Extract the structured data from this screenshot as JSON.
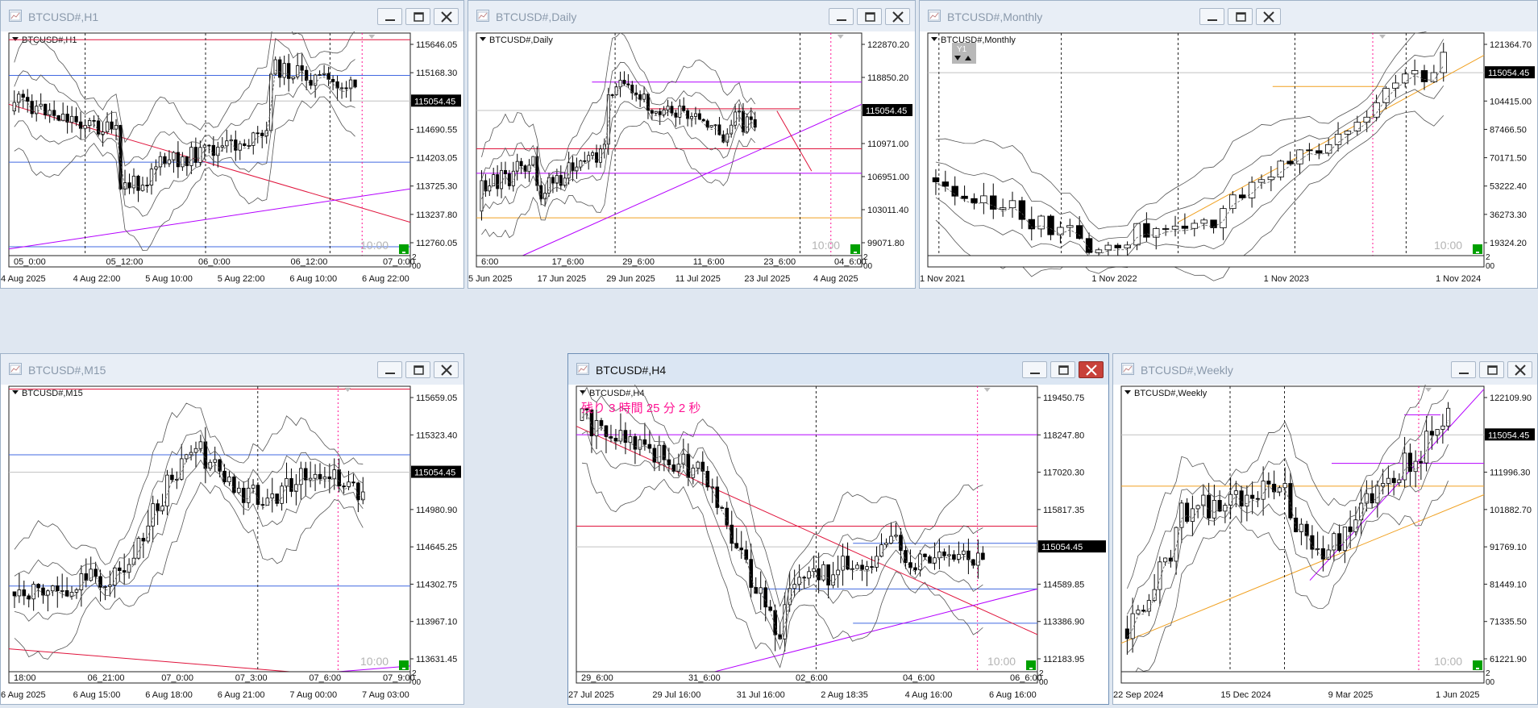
{
  "colors": {
    "red_line": "#e0143c",
    "blue_line": "#4169e1",
    "magenta_line": "#b400ff",
    "orange_line": "#f0a020",
    "price_label_bg": "#000000",
    "session_marker": "#ff1493",
    "bull_candle": "#ffffff",
    "bear_candle": "#000000",
    "green_box": "#00a000"
  },
  "session_label": "10:00",
  "windows": [
    {
      "id": "h1",
      "title": "BTCUSD#,H1",
      "label": "BTCUSD#,H1",
      "active": false,
      "prices": [
        "115646.05",
        "115168.30",
        "115054.45",
        "114690.55",
        "114203.05",
        "113725.30",
        "113237.80",
        "112760.05"
      ],
      "current_price": "115054.45",
      "time_top": [
        "05_0:00",
        "05_12:00",
        "06_0:00",
        "06_12:00",
        "07_0:00"
      ],
      "time_bottom": [
        "4 Aug 2025",
        "4 Aug 22:00",
        "5 Aug 10:00",
        "5 Aug 22:00",
        "6 Aug 10:00",
        "6 Aug 22:00"
      ],
      "scale_marker": "2\n00"
    },
    {
      "id": "daily",
      "title": "BTCUSD#,Daily",
      "label": "BTCUSD#,Daily",
      "active": false,
      "prices": [
        "122870.20",
        "118850.20",
        "115054.45",
        "110971.00",
        "106951.00",
        "103011.40",
        "99071.80"
      ],
      "current_price": "115054.45",
      "time_top": [
        "6:00",
        "17_6:00",
        "29_6:00",
        "11_6:00",
        "23_6:00",
        "04_6:00"
      ],
      "time_bottom": [
        "5 Jun 2025",
        "17 Jun 2025",
        "29 Jun 2025",
        "11 Jul 2025",
        "23 Jul 2025",
        "4 Aug 2025"
      ],
      "scale_marker": "2\n00"
    },
    {
      "id": "monthly",
      "title": "BTCUSD#,Monthly",
      "label": "BTCUSD#,Monthly",
      "active": false,
      "prices": [
        "121364.70",
        "115054.45",
        "104415.00",
        "87466.50",
        "70171.50",
        "53222.40",
        "36273.30",
        "19324.20"
      ],
      "current_price": "115054.45",
      "time_top": [],
      "time_bottom": [
        "1 Nov 2021",
        "1 Nov 2022",
        "1 Nov 2023",
        "1 Nov 2024"
      ],
      "scale_marker": "2\n00",
      "widget_label": "Y1"
    },
    {
      "id": "m15",
      "title": "BTCUSD#,M15",
      "label": "BTCUSD#,M15",
      "active": false,
      "prices": [
        "115659.05",
        "115323.40",
        "115054.45",
        "114980.90",
        "114645.25",
        "114302.75",
        "113967.10",
        "113631.45"
      ],
      "current_price": "115054.45",
      "time_top": [
        "18:00",
        "06_21:00",
        "07_0:00",
        "07_3:00",
        "07_6:00",
        "07_9:00"
      ],
      "time_bottom": [
        "6 Aug 2025",
        "6 Aug 15:00",
        "6 Aug 18:00",
        "6 Aug 21:00",
        "7 Aug 00:00",
        "7 Aug 03:00"
      ],
      "scale_marker": "2\n00"
    },
    {
      "id": "h4",
      "title": "BTCUSD#,H4",
      "label": "BTCUSD#,H4",
      "active": true,
      "prices": [
        "119450.75",
        "118247.80",
        "117020.30",
        "115817.35",
        "115054.45",
        "114589.85",
        "113386.90",
        "112183.95"
      ],
      "current_price": "115054.45",
      "time_top": [
        "29_6:00",
        "31_6:00",
        "02_6:00",
        "04_6:00",
        "06_6:00"
      ],
      "time_bottom": [
        "27 Jul 2025",
        "29 Jul 16:00",
        "31 Jul 16:00",
        "2 Aug 18:35",
        "4 Aug 16:00",
        "6 Aug 16:00"
      ],
      "scale_marker": "2\n00",
      "countdown": "残り 3 時間 25 分 2 秒"
    },
    {
      "id": "weekly",
      "title": "BTCUSD#,Weekly",
      "label": "BTCUSD#,Weekly",
      "active": false,
      "prices": [
        "122109.90",
        "115054.45",
        "111996.30",
        "101882.70",
        "91769.10",
        "81449.10",
        "71335.50",
        "61221.90"
      ],
      "current_price": "115054.45",
      "time_top": [],
      "time_bottom": [
        "22 Sep 2024",
        "15 Dec 2024",
        "9 Mar 2025",
        "1 Jun 2025"
      ],
      "scale_marker": "2\n00"
    }
  ]
}
